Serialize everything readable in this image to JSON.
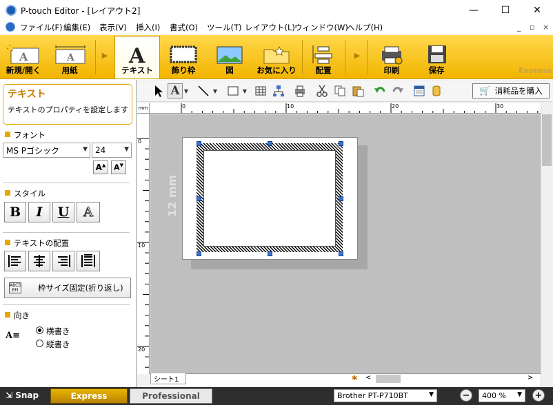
{
  "window": {
    "title": "P-touch Editor - [レイアウト2]",
    "minimize": "—",
    "maximize": "☐",
    "close": "✕"
  },
  "menu": {
    "items": [
      "ファイル(F)",
      "編集(E)",
      "表示(V)",
      "挿入(I)",
      "書式(O)",
      "ツール(T)",
      "レイアウト(L)",
      "ウィンドウ(W)",
      "ヘルプ(H)"
    ],
    "mdi": [
      "_",
      "▫",
      "×"
    ]
  },
  "ribbon": {
    "buttons": [
      "新規/開く",
      "用紙",
      "テキスト",
      "飾り枠",
      "図",
      "お気に入り",
      "配置",
      "印刷",
      "保存"
    ],
    "brand": "Express"
  },
  "panel": {
    "title": "テキスト",
    "description": "テキストのプロパティを設定します",
    "font_section": "フォント",
    "font_name": "MS Pゴシック",
    "font_size": "24",
    "style_section": "スタイル",
    "style_buttons": [
      "B",
      "I",
      "U",
      "A"
    ],
    "align_section": "テキストの配置",
    "fixed_frame": "枠サイズ固定(折り返し)",
    "fixed_frame_icon_text": "ABCD EFI",
    "orientation_section": "向き",
    "orient_horizontal": "横書き",
    "orient_vertical": "縦書き"
  },
  "toolbar": {
    "consumables": "消耗品を購入"
  },
  "ruler": {
    "unit": "mm",
    "h_labels": [
      "0",
      "10",
      "20",
      "30"
    ],
    "v_labels": [
      "0",
      "10",
      "20"
    ]
  },
  "canvas": {
    "tape_label": "12 mm"
  },
  "sheet": {
    "tab": "シート1"
  },
  "status": {
    "snap": "Snap",
    "mode_express": "Express",
    "mode_professional": "Professional",
    "printer": "Brother PT-P710BT",
    "zoom": "400 %"
  }
}
